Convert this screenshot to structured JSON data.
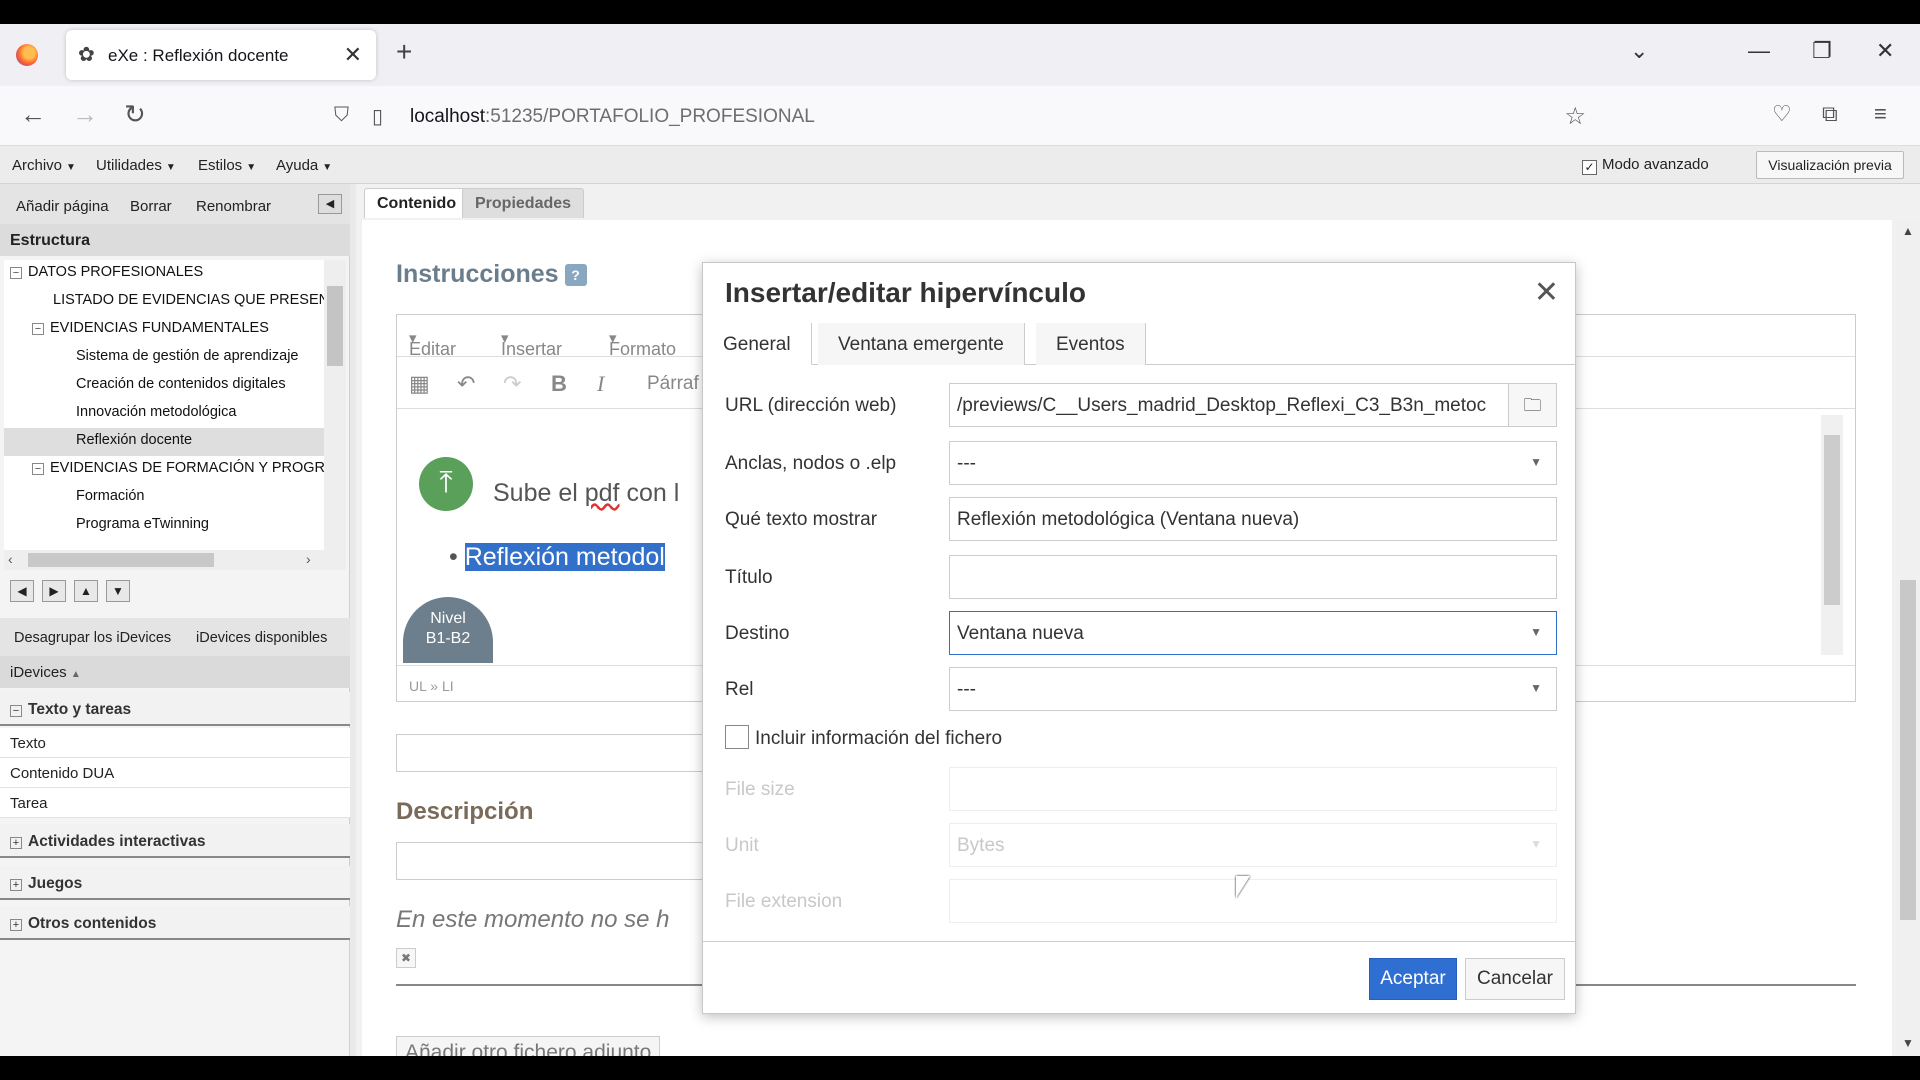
{
  "browser": {
    "tab_title": "eXe : Reflexión docente",
    "url_host": "localhost",
    "url_rest": ":51235/PORTAFOLIO_PROFESIONAL",
    "new_tab": "+",
    "tab_close": "✕"
  },
  "menubar": {
    "items": [
      "Archivo",
      "Utilidades",
      "Estilos",
      "Ayuda"
    ],
    "advanced_mode": "Modo avanzado",
    "preview": "Visualización previa"
  },
  "left": {
    "toolbar": {
      "add": "Añadir página",
      "delete": "Borrar",
      "rename": "Renombrar"
    },
    "structure_title": "Estructura",
    "tree": [
      {
        "label": "DATOS PROFESIONALES",
        "level": 0,
        "expander": "−"
      },
      {
        "label": "LISTADO DE EVIDENCIAS QUE PRESENT",
        "level": 1
      },
      {
        "label": "EVIDENCIAS FUNDAMENTALES",
        "level": 1,
        "expander": "−"
      },
      {
        "label": "Sistema de gestión de aprendizaje",
        "level": 2
      },
      {
        "label": "Creación de contenidos digitales",
        "level": 2
      },
      {
        "label": "Innovación metodológica",
        "level": 2
      },
      {
        "label": "Reflexión docente",
        "level": 2,
        "selected": true
      },
      {
        "label": "EVIDENCIAS DE FORMACIÓN Y PROGRA",
        "level": 1,
        "expander": "−"
      },
      {
        "label": "Formación",
        "level": 2
      },
      {
        "label": "Programa eTwinning",
        "level": 2
      }
    ],
    "idevices_bar": {
      "ungroup": "Desagrupar los iDevices",
      "available": "iDevices disponibles"
    },
    "idevices_sort": "iDevices",
    "categories": {
      "text_tasks": "Texto y tareas",
      "items": [
        "Texto",
        "Contenido DUA",
        "Tarea"
      ],
      "interactive": "Actividades interactivas",
      "games": "Juegos",
      "other": "Otros contenidos"
    }
  },
  "center": {
    "tabs": {
      "content": "Contenido",
      "properties": "Propiedades"
    },
    "instructions_title": "Instrucciones",
    "editor_menu": [
      "Editar",
      "Insertar",
      "Formato"
    ],
    "paragraph": "Párraf",
    "upload_text_a": "Sube el ",
    "upload_text_pdf": "pdf",
    "upload_text_b": " con l",
    "bullet_text": "Reflexión metodol",
    "badge_line1": "Nivel",
    "badge_line2": "B1-B2",
    "status_path": "UL » LI",
    "description_title": "Descripción",
    "italic_note": "En este momento no se h",
    "add_file": "Añadir otro fichero adjunto"
  },
  "modal": {
    "title": "Insertar/editar hipervínculo",
    "tabs": [
      "General",
      "Ventana emergente",
      "Eventos"
    ],
    "fields": {
      "url_label": "URL (dirección web)",
      "url_value": "/previews/C__Users_madrid_Desktop_Reflexi_C3_B3n_metoc",
      "anchors_label": "Anclas, nodos o .elp",
      "anchors_value": "---",
      "text_label": "Qué texto mostrar",
      "text_value": "Reflexión metodológica (Ventana nueva)",
      "title_label": "Título",
      "title_value": "",
      "target_label": "Destino",
      "target_value": "Ventana nueva",
      "rel_label": "Rel",
      "rel_value": "---",
      "include_file_info": "Incluir información del fichero",
      "file_size_label": "File size",
      "unit_label": "Unit",
      "unit_value": "Bytes",
      "file_ext_label": "File extension"
    },
    "ok": "Aceptar",
    "cancel": "Cancelar"
  }
}
